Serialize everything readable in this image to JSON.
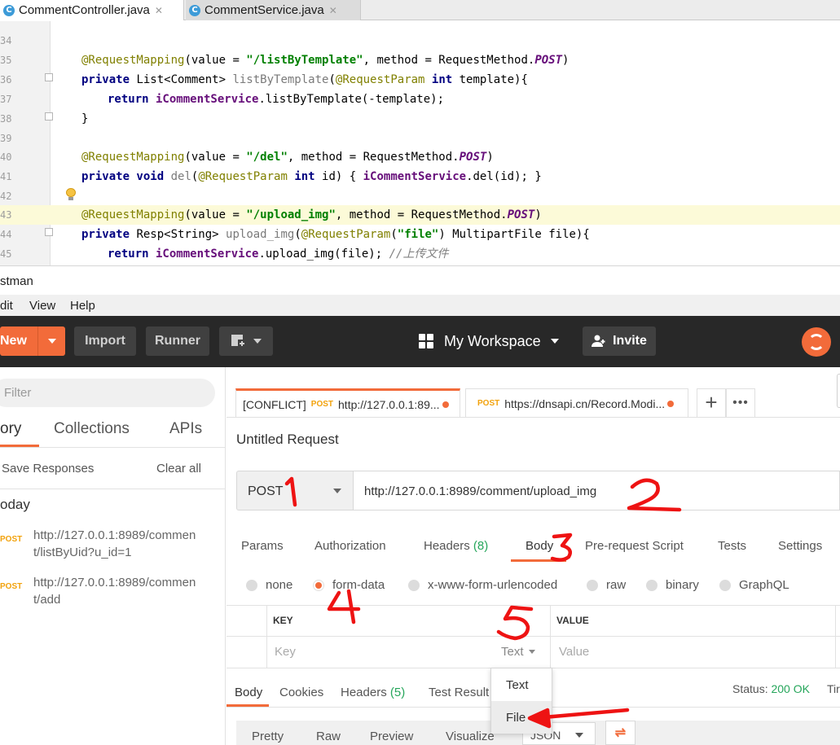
{
  "ide": {
    "tabs": [
      {
        "label": "CommentController.java",
        "icon": "java-class-icon"
      },
      {
        "label": "CommentService.java",
        "icon": "java-class-icon"
      }
    ],
    "line_numbers": [
      "34",
      "35",
      "36",
      "37",
      "38",
      "39",
      "40",
      "41",
      "42",
      "43",
      "44",
      "45"
    ],
    "code": {
      "l35": {
        "ann": "@RequestMapping",
        "a": "(value = ",
        "s": "\"/listByTemplate\"",
        "b": ", method = RequestMethod.",
        "c": "POST",
        "d": ")"
      },
      "l36": {
        "kw": "private",
        "a": " List<Comment> ",
        "fn": "listByTemplate",
        "b": "(",
        "ann": "@RequestParam",
        "kw2": " int",
        "c": " template){"
      },
      "l37": {
        "kw": "return",
        "fld": " iCommentService",
        "a": ".listByTemplate(-template);"
      },
      "l38": {
        "a": "}"
      },
      "l40": {
        "ann": "@RequestMapping",
        "a": "(value = ",
        "s": "\"/del\"",
        "b": ", method = RequestMethod.",
        "c": "POST",
        "d": ")"
      },
      "l41": {
        "kw": "private void",
        "fn": " del",
        "a": "(",
        "ann": "@RequestParam",
        "kw2": " int",
        "b": " id) { ",
        "fld": "iCommentService",
        "c": ".del(id); }"
      },
      "l43": {
        "ann": "@RequestMapping",
        "a": "(value = ",
        "s": "\"/upload_img\"",
        "b": ", method = RequestMethod.",
        "c": "POST",
        "d": ")"
      },
      "l44": {
        "kw": "private",
        "a": " Resp<String> ",
        "fn": "upload_img",
        "b": "(",
        "ann": "@RequestParam",
        "c": "(",
        "s": "\"file\"",
        "d": ") MultipartFile file){"
      },
      "l45": {
        "kw": "return",
        "fld": " iCommentService",
        "a": ".upload_img(file); ",
        "cmt": "//上传文件"
      }
    }
  },
  "postman": {
    "title": "stman",
    "menu": [
      "Edit",
      "View",
      "Help"
    ],
    "menu_display": [
      "dit",
      "View",
      "Help"
    ],
    "header": {
      "new_label": "New",
      "import_label": "Import",
      "runner_label": "Runner",
      "workspace_label": "My Workspace",
      "invite_label": "Invite"
    },
    "sidebar": {
      "filter_placeholder": "Filter",
      "tabs": [
        "ory",
        "Collections",
        "APIs"
      ],
      "save_responses": "Save Responses",
      "clear_all": "Clear all",
      "group": "oday",
      "history": [
        {
          "method": "POST",
          "url_line1": "http://127.0.0.1:8989/commen",
          "url_line2": "t/listByUid?u_id=1"
        },
        {
          "method": "POST",
          "url_line1": "http://127.0.0.1:8989/commen",
          "url_line2": "t/add"
        }
      ]
    },
    "request_tabs": [
      {
        "prefix": "[CONFLICT]",
        "method": "POST",
        "url": "http://127.0.0.1:89..."
      },
      {
        "prefix": "",
        "method": "POST",
        "url": "https://dnsapi.cn/Record.Modi..."
      }
    ],
    "tab_add": "+",
    "tab_more": "•••",
    "request_name": "Untitled Request",
    "method": "POST",
    "url": "http://127.0.0.1:8989/comment/upload_img",
    "request_subtabs": [
      {
        "label": "Params",
        "count": ""
      },
      {
        "label": "Authorization",
        "count": ""
      },
      {
        "label": "Headers",
        "count": "(8)"
      },
      {
        "label": "Body",
        "count": ""
      },
      {
        "label": "Pre-request Script",
        "count": ""
      },
      {
        "label": "Tests",
        "count": ""
      },
      {
        "label": "Settings",
        "count": ""
      }
    ],
    "body_types": [
      "none",
      "form-data",
      "x-www-form-urlencoded",
      "raw",
      "binary",
      "GraphQL"
    ],
    "body_type_selected": "form-data",
    "kv": {
      "key_header": "KEY",
      "value_header": "VALUE",
      "key_placeholder": "Key",
      "value_placeholder": "Value",
      "type_value": "Text"
    },
    "type_dropdown": [
      "Text",
      "File"
    ],
    "response_tabs": [
      {
        "label": "Body",
        "count": ""
      },
      {
        "label": "Cookies",
        "count": ""
      },
      {
        "label": "Headers",
        "count": "(5)"
      },
      {
        "label": "Test Result",
        "count": ""
      }
    ],
    "status_label": "Status:",
    "status_value": "200 OK",
    "time_label": "Tir",
    "response_view": [
      "Pretty",
      "Raw",
      "Preview",
      "Visualize"
    ],
    "response_format": "JSON"
  },
  "colors": {
    "accent": "#f26b3a",
    "header_bg": "#282828",
    "success": "#26a65b",
    "annotation": "#ee1313",
    "method_post": "#f2a20c"
  }
}
